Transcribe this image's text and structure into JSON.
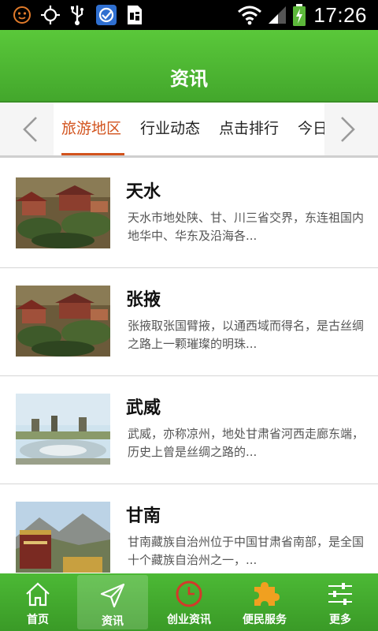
{
  "status_bar": {
    "time": "17:26",
    "left_icons": [
      "emoji-icon",
      "gps-icon",
      "usb-icon",
      "app-icon",
      "document-icon"
    ],
    "right_icons": [
      "wifi-icon",
      "signal-icon",
      "battery-charging-icon"
    ]
  },
  "header": {
    "title": "资讯"
  },
  "tabs": {
    "items": [
      {
        "label": "旅游地区",
        "active": true
      },
      {
        "label": "行业动态",
        "active": false
      },
      {
        "label": "点击排行",
        "active": false
      },
      {
        "label": "今日",
        "active": false
      }
    ],
    "accent_color": "#d2531d"
  },
  "articles": [
    {
      "title": "天水",
      "desc": "天水市地处陕、甘、川三省交界，东连祖国内地华中、华东及沿海各..."
    },
    {
      "title": "张掖",
      "desc": "张掖取张国臂掖，以通西域而得名，是古丝绸之路上一颗璀璨的明珠..."
    },
    {
      "title": "武威",
      "desc": "武威，亦称凉州，地处甘肃省河西走廊东端，历史上曾是丝绸之路的..."
    },
    {
      "title": "甘南",
      "desc": "甘南藏族自治州位于中国甘肃省南部，是全国十个藏族自治州之一，..."
    }
  ],
  "bottom_nav": {
    "items": [
      {
        "label": "首页",
        "icon": "home-icon",
        "active": false
      },
      {
        "label": "资讯",
        "icon": "send-icon",
        "active": true
      },
      {
        "label": "创业资讯",
        "icon": "clock-icon",
        "active": false
      },
      {
        "label": "便民服务",
        "icon": "puzzle-icon",
        "active": false
      },
      {
        "label": "更多",
        "icon": "sliders-icon",
        "active": false
      }
    ]
  },
  "colors": {
    "brand_green": "#4cb935",
    "accent_orange": "#d2531d"
  }
}
